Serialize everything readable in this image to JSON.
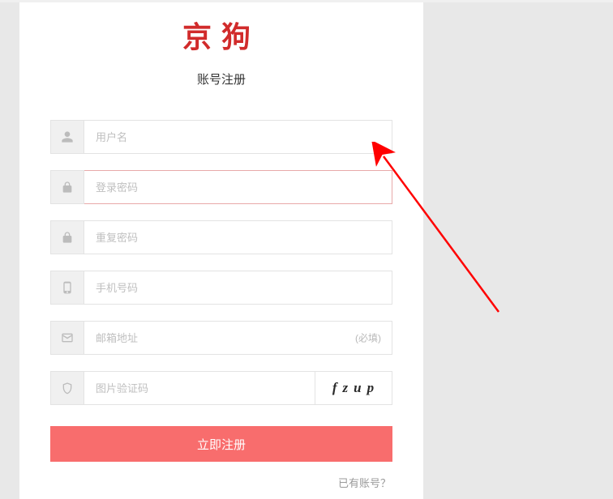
{
  "logo": "京狗",
  "subtitle": "账号注册",
  "fields": {
    "username": {
      "placeholder": "用户名"
    },
    "password": {
      "placeholder": "登录密码"
    },
    "password2": {
      "placeholder": "重复密码"
    },
    "phone": {
      "placeholder": "手机号码"
    },
    "email": {
      "placeholder": "邮箱地址",
      "required_text": "(必填)"
    },
    "captcha": {
      "placeholder": "图片验证码",
      "code": "fzup"
    }
  },
  "submit_label": "立即注册",
  "login_link": "已有账号？"
}
